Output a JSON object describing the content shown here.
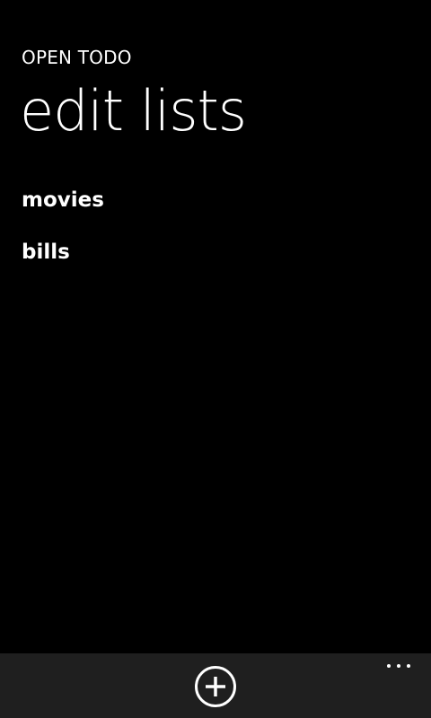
{
  "header": {
    "app_title": "OPEN TODO",
    "page_title": "edit lists"
  },
  "lists": [
    {
      "label": "movies"
    },
    {
      "label": "bills"
    }
  ],
  "app_bar": {
    "background": "#1f1f1f",
    "buttons": [
      {
        "icon": "add-circle-icon"
      },
      {
        "icon": "ellipsis-icon"
      }
    ]
  },
  "theme": {
    "background": "#000000",
    "foreground": "#ffffff"
  }
}
